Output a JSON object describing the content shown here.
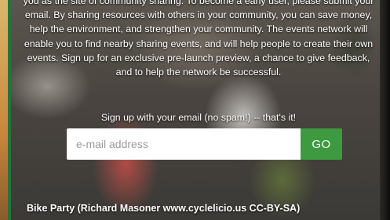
{
  "intro_text": "you as the site of community sharing. To become a early user, please submit your email. By sharing resources with others in your community, you can save money, help the environment, and strengthen your community. The events network will enable you to find nearby sharing events, and will help people to create their own events. Sign up for an exclusive pre-launch preview, a chance to give feedback, and to help the network be successful.",
  "signup": {
    "label": "Sign up with your email (no spam!) -- that's it!",
    "email_placeholder": "e-mail address",
    "email_value": "",
    "go_label": "GO"
  },
  "photo_credit": "Bike Party (Richard Masoner www.cyclelicio.us CC-BY-SA)",
  "colors": {
    "go_button": "#3d9a3f",
    "text": "#ffffff"
  }
}
